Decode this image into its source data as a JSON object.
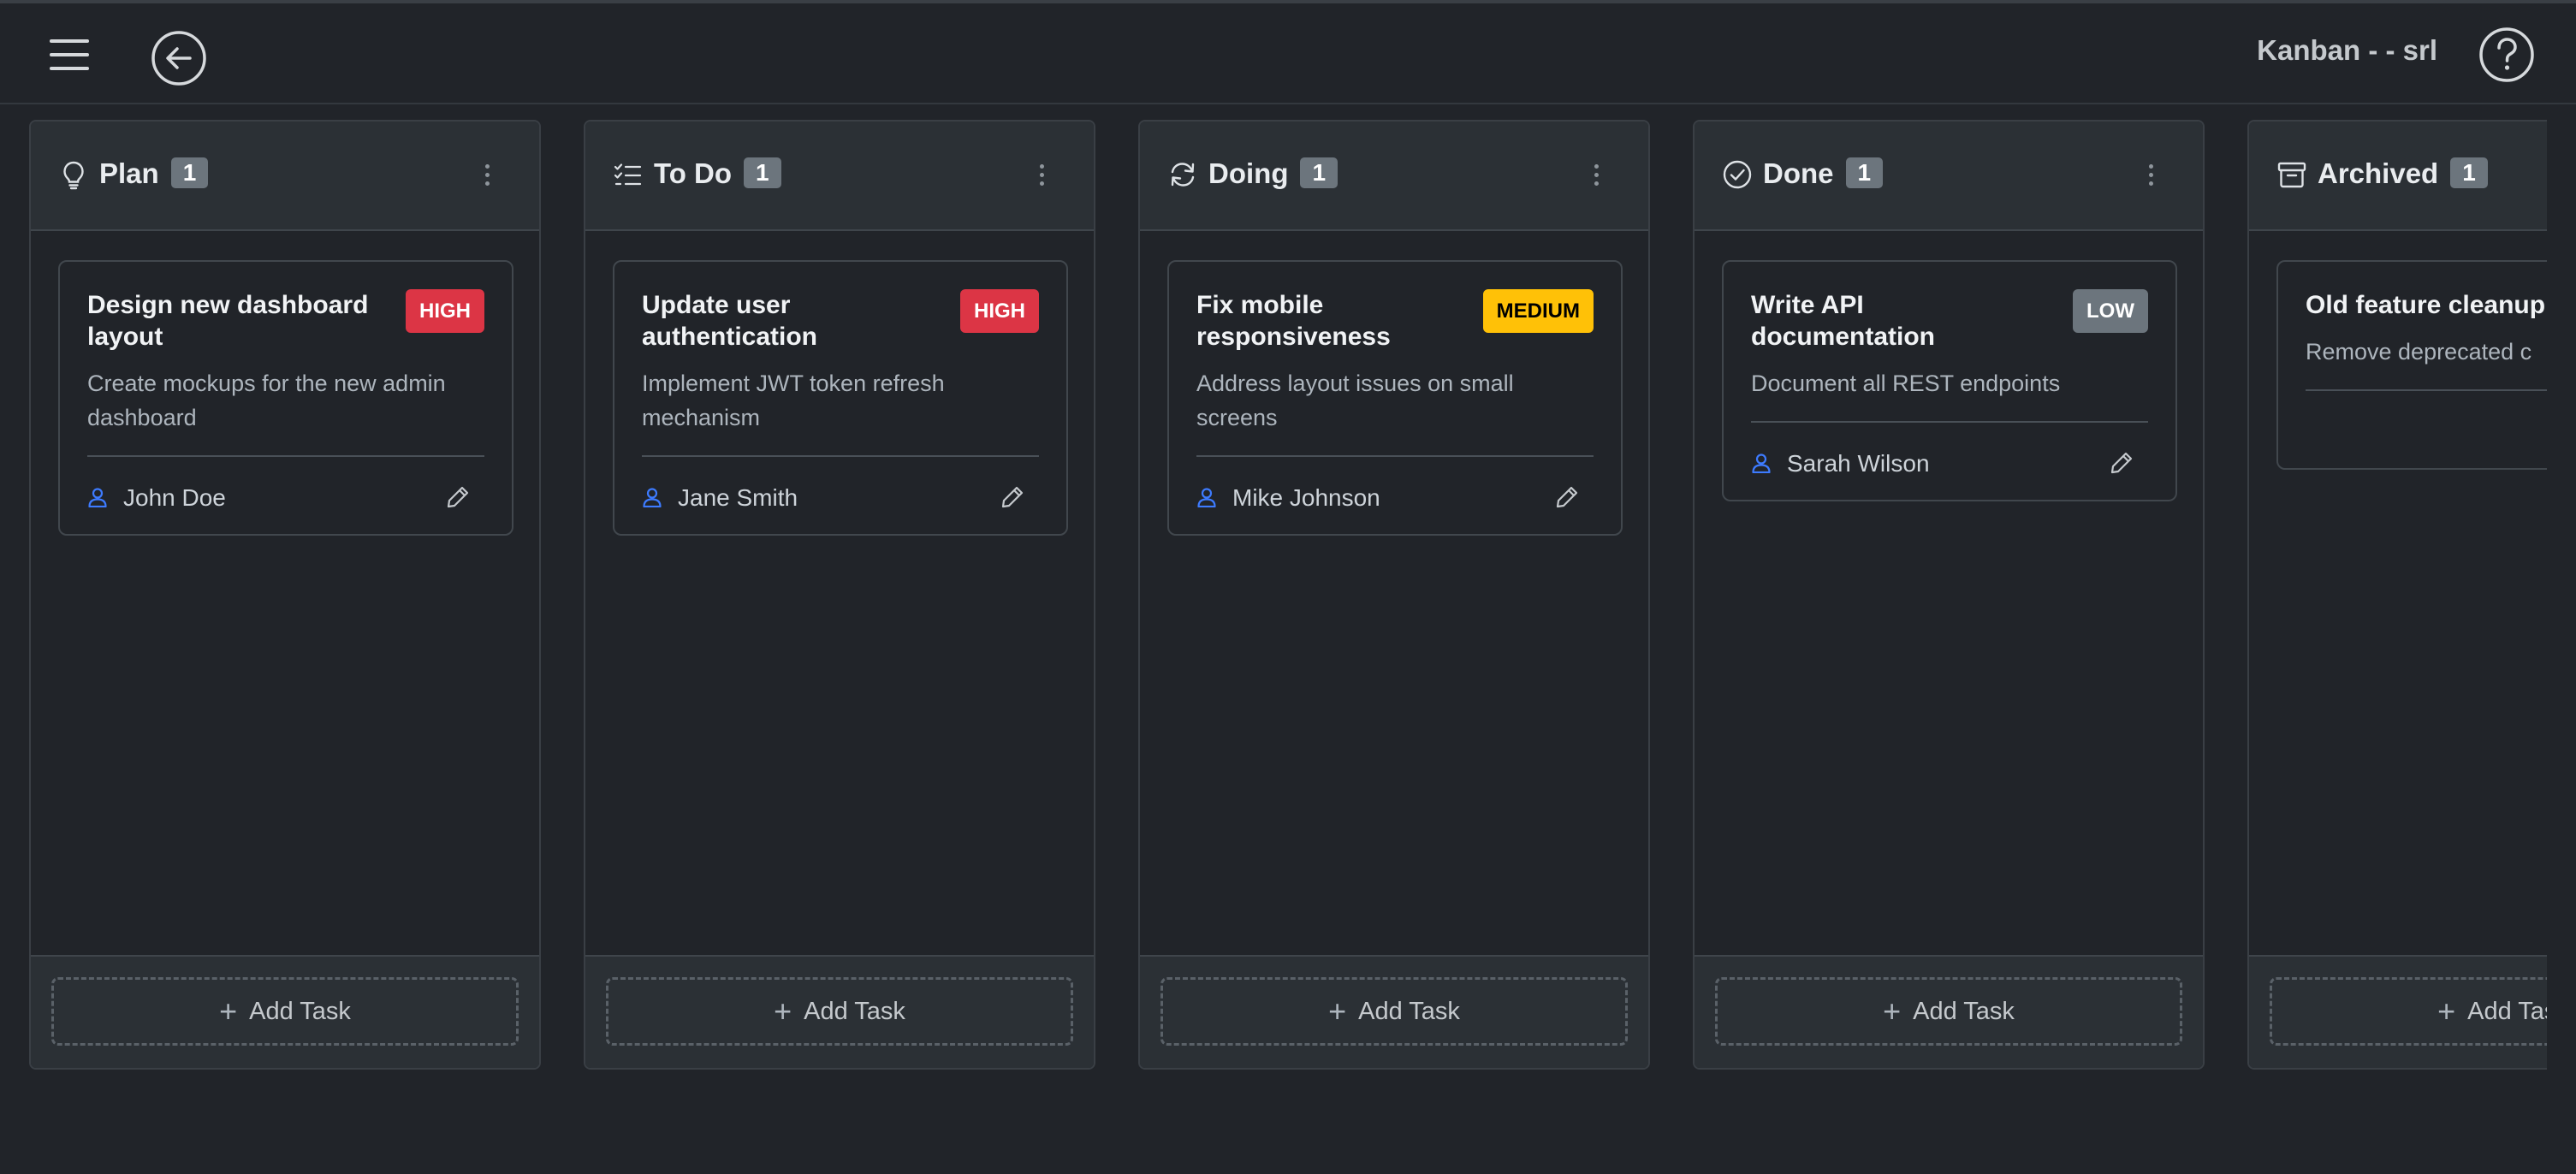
{
  "app": {
    "title": "Kanban - - srl"
  },
  "icons": {
    "menu": "hamburger-menu-icon",
    "back": "arrow-left-circle-icon",
    "help": "question-circle-icon"
  },
  "colors": {
    "high": "#dc3545",
    "medium": "#ffc107",
    "low": "#6c757d",
    "assignee_icon": "#3d7bff"
  },
  "add_task_label": "Add Task",
  "columns": [
    {
      "title": "Plan",
      "icon": "lightbulb-icon",
      "count": "1",
      "card": {
        "title": "Design new dashboard layout",
        "priority": "HIGH",
        "description": [
          "Create mockups for the new admin",
          "dashboard"
        ],
        "assignee": "John Doe"
      }
    },
    {
      "title": "To Do",
      "icon": "list-check-icon",
      "count": "1",
      "card": {
        "title": "Update user authentication",
        "priority": "HIGH",
        "description": [
          "Implement JWT token refresh",
          "mechanism"
        ],
        "assignee": "Jane Smith"
      }
    },
    {
      "title": "Doing",
      "icon": "refresh-icon",
      "count": "1",
      "card": {
        "title": "Fix mobile responsiveness",
        "priority": "MEDIUM",
        "description": [
          "Address layout issues on small",
          "screens"
        ],
        "assignee": "Mike Johnson"
      }
    },
    {
      "title": "Done",
      "icon": "check-circle-icon",
      "count": "1",
      "card": {
        "title": "Write API documentation",
        "priority": "LOW",
        "description": [
          "Document all REST endpoints"
        ],
        "assignee": "Sarah Wilson"
      }
    },
    {
      "title": "Archived",
      "icon": "archive-icon",
      "count": "1",
      "card": {
        "title": "Old feature cleanup",
        "priority": "",
        "description": [
          "Remove deprecated c"
        ],
        "assignee": ""
      }
    }
  ]
}
